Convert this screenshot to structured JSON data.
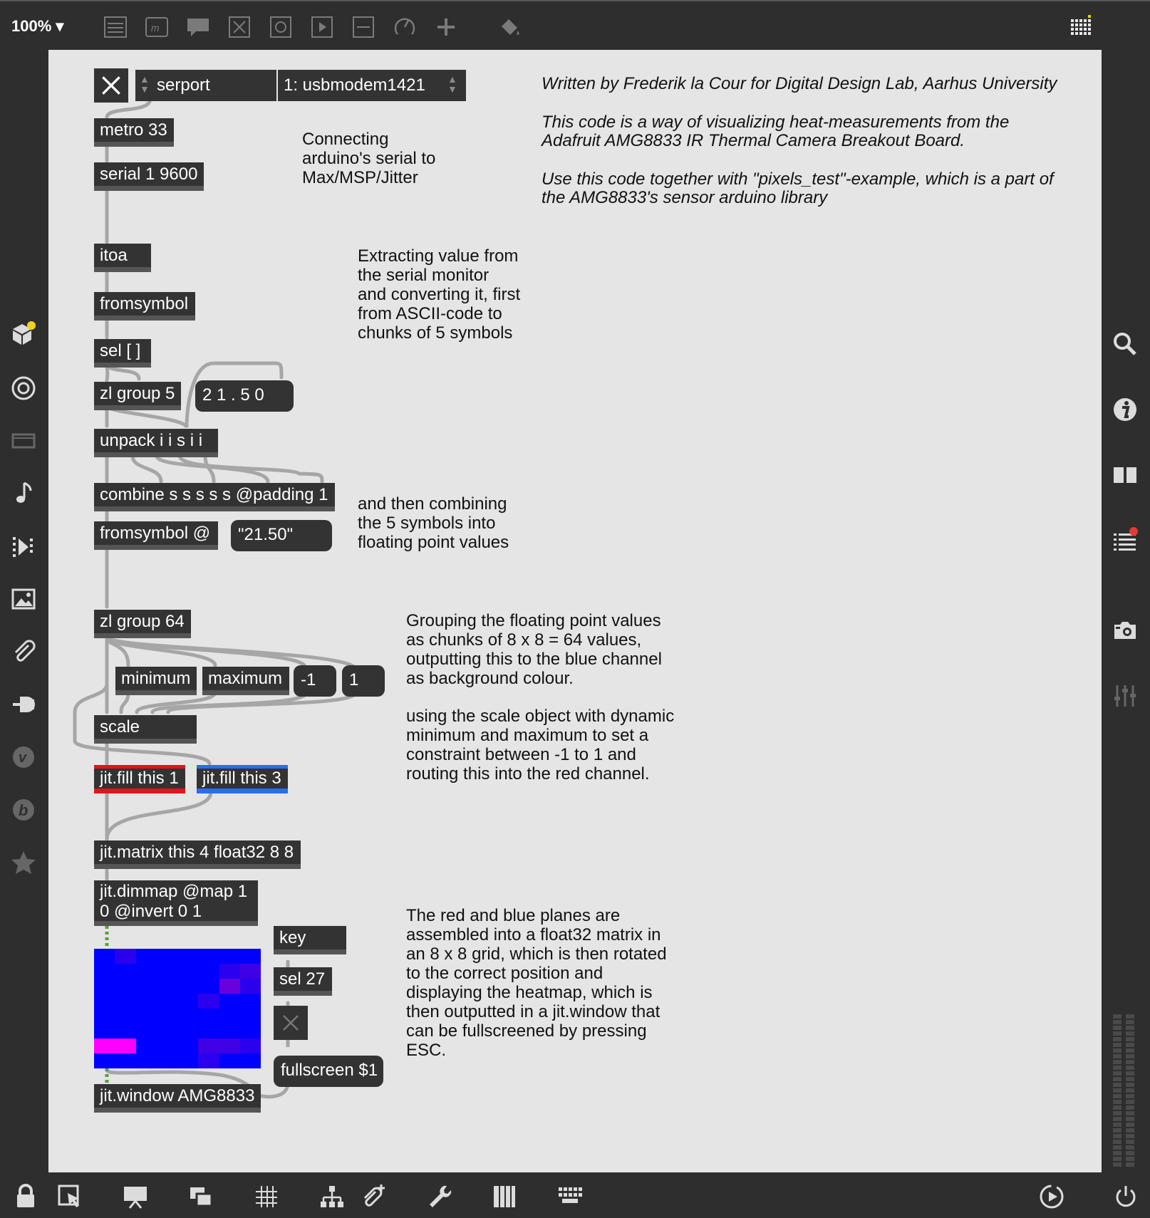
{
  "toolbar": {
    "zoom_label": "100% ▾",
    "icons": [
      "list-icon",
      "message-icon",
      "comment-icon",
      "toggle-box-icon",
      "button-icon",
      "play-icon",
      "slider-icon",
      "dial-icon",
      "plus-icon",
      "paint-bucket-icon",
      "grid-icon"
    ]
  },
  "patch": {
    "objects": {
      "serport_menu": "serport",
      "port_menu": "1: usbmodem1421",
      "metro": "metro 33",
      "serial": "serial 1 9600",
      "itoa": "itoa",
      "fromsymbol1": "fromsymbol",
      "sel": "sel [ ]",
      "zlgroup5": "zl group 5",
      "msg_digits": "2 1 . 5 0",
      "unpack": "unpack i i s i i",
      "combine": "combine s s s s s @padding 1",
      "fromsymbol2": "fromsymbol @",
      "msg_value": "\"21.50\"",
      "zlgroup64": "zl group 64",
      "minimum": "minimum",
      "maximum": "maximum",
      "msg_neg1": "-1",
      "msg_1": "1",
      "scale": "scale",
      "jitfill1": "jit.fill this 1",
      "jitfill3": "jit.fill this 3",
      "jitmatrix": "jit.matrix this 4 float32 8 8",
      "jitdimmap_l1": "jit.dimmap @map 1",
      "jitdimmap_l2": "0 @invert 0 1",
      "key": "key",
      "sel27": "sel 27",
      "fullscreen": "fullscreen $1",
      "jitwindow": "jit.window AMG8833"
    },
    "comments": {
      "credit": "Written by Frederik la Cour for Digital Design Lab, Aarhus University",
      "purpose_l1": "This code is a way of visualizing heat-measurements from the",
      "purpose_l2": "Adafruit AMG8833 IR Thermal Camera Breakout Board.",
      "usage_l1": "Use this code together with \"pixels_test\"-example, which is a part of",
      "usage_l2": "the AMG8833's sensor arduino library",
      "connecting": "Connecting\narduino's serial to\nMax/MSP/Jitter",
      "extracting": "Extracting value from\nthe serial monitor\nand converting it, first\nfrom ASCII-code to\nchunks of 5 symbols",
      "combining": "and then combining\nthe 5 symbols into\nfloating point values",
      "grouping": "Grouping the floating point values\nas chunks of 8 x 8 = 64 values,\noutputting this to the blue channel\nas background colour.",
      "scaling": "using the scale object with dynamic\nminimum and maximum to set a\nconstraint between -1 to 1 and\nrouting this into the red channel.",
      "assembling": "The red and blue planes are\nassembled into a float32 matrix in\nan 8 x 8 grid, which is then rotated\nto the correct position and\ndisplaying the heatmap, which is\nthen outputted in a jit.window that\ncan be fullscreened by pressing\nESC."
    },
    "heatmap": {
      "rows": 8,
      "cols": 8,
      "colors": {
        "base": "#0000ff",
        "cool": "#2a00ee",
        "mid": "#3f00e6",
        "warm": "#6a00dd",
        "hot": "#ff00ff"
      },
      "cells": [
        [
          "base",
          "cool",
          "base",
          "base",
          "base",
          "base",
          "base",
          "base"
        ],
        [
          "base",
          "base",
          "base",
          "base",
          "base",
          "base",
          "cool",
          "mid"
        ],
        [
          "base",
          "base",
          "base",
          "base",
          "base",
          "base",
          "warm",
          "cool"
        ],
        [
          "base",
          "base",
          "base",
          "base",
          "base",
          "cool",
          "base",
          "base"
        ],
        [
          "base",
          "base",
          "base",
          "base",
          "base",
          "base",
          "base",
          "base"
        ],
        [
          "base",
          "base",
          "base",
          "base",
          "base",
          "base",
          "base",
          "base"
        ],
        [
          "hot",
          "hot",
          "base",
          "base",
          "base",
          "mid",
          "mid",
          "cool"
        ],
        [
          "base",
          "base",
          "base",
          "base",
          "base",
          "cool",
          "base",
          "base"
        ]
      ]
    }
  },
  "colors": {
    "red_outlet": "#e0141c",
    "blue_outlet": "#2a6dee",
    "canvas": "#e5e5e5",
    "chrome": "#2e2e2e"
  }
}
